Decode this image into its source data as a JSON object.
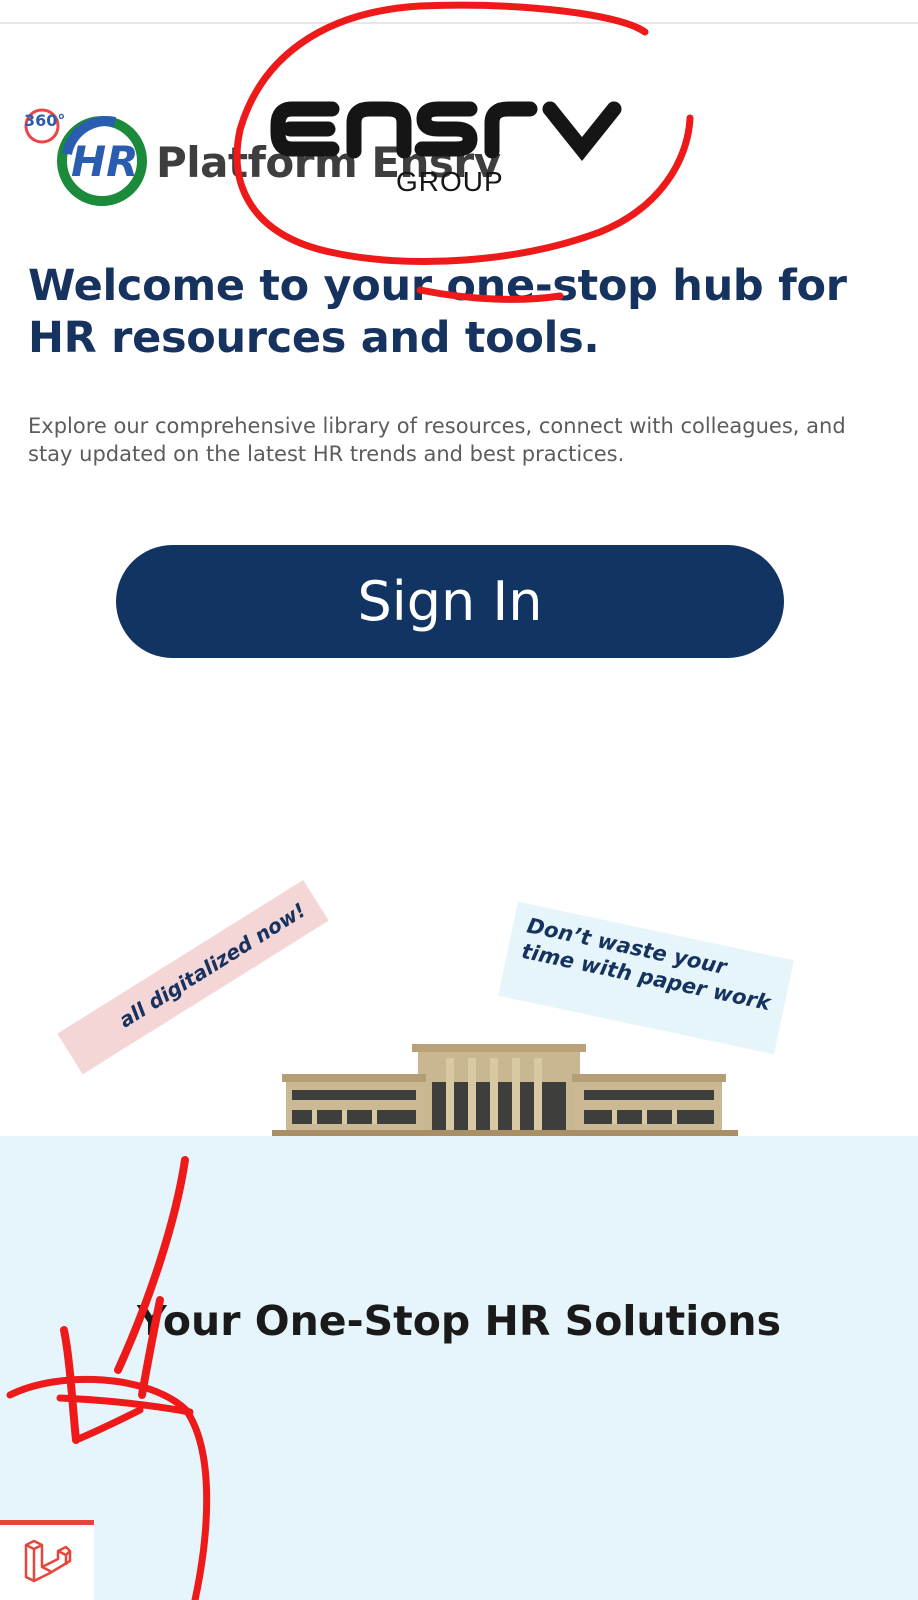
{
  "logo": {
    "badge_360": "360°",
    "badge_hr": "HR",
    "platform_text": "Platform Ensrv",
    "brand_name": "ENSRV",
    "brand_group": "GROUP"
  },
  "hero": {
    "headline": "Welcome to your one-stop hub for HR resources and tools.",
    "description": "Explore our comprehensive library of resources, connect with colleagues, and stay updated on the latest HR trends and best practices.",
    "sign_in_label": "Sign In"
  },
  "illustration": {
    "banner_left": "all digitalized now!",
    "banner_right": "Don’t waste your time with paper work"
  },
  "solutions": {
    "title": "Your One-Stop HR Solutions"
  },
  "colors": {
    "primary_navy": "#123462",
    "headline_navy": "#16325f",
    "section_bg": "#e5f5fb",
    "annotation_red": "#ee1a1a",
    "widget_accent": "#e5463b"
  },
  "icons": {
    "corner_widget": "laravel-logo-icon"
  }
}
